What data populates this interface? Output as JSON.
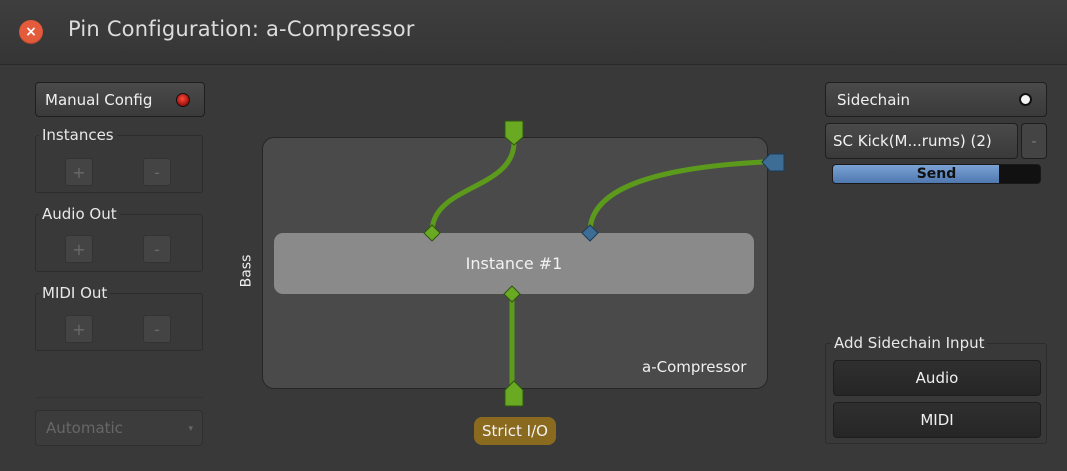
{
  "window": {
    "title": "Pin Configuration: a-Compressor",
    "close_glyph": "×"
  },
  "left_panel": {
    "manual_config_label": "Manual Config",
    "instances_label": "Instances",
    "audio_out_label": "Audio Out",
    "midi_out_label": "MIDI Out",
    "plus_glyph": "+",
    "minus_glyph": "-",
    "mode_combo_value": "Automatic",
    "combo_arrow_glyph": "▾"
  },
  "routing": {
    "instance_label": "Instance #1",
    "plugin_name": "a-Compressor",
    "bass_label": "Bass",
    "strict_io_label": "Strict I/O"
  },
  "right_panel": {
    "sidechain_label": "Sidechain",
    "sc_source_label": "SC Kick(M...rums) (2)",
    "sc_source_minus": "-",
    "send_label": "Send",
    "send_level": 0.8,
    "add_sidechain_label": "Add Sidechain Input",
    "audio_button": "Audio",
    "midi_button": "MIDI"
  },
  "colors": {
    "wire_green": "#5c9a1c",
    "pin_green": "#6aaa22",
    "pin_blue": "#3d6d95",
    "led_red": "#c0201a",
    "send_blue": "#6690c8",
    "strict_badge": "#8a6a1e"
  }
}
